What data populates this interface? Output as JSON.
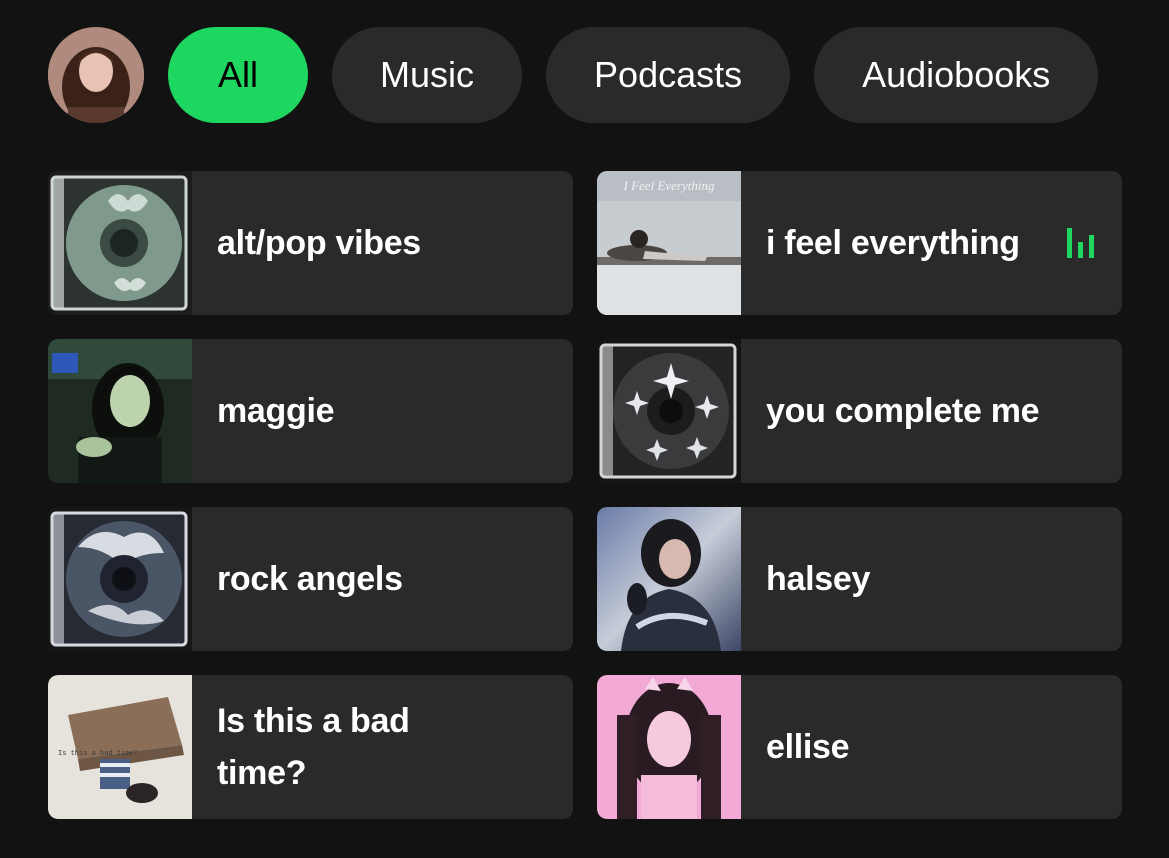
{
  "filters": [
    {
      "label": "All",
      "active": true
    },
    {
      "label": "Music",
      "active": false
    },
    {
      "label": "Podcasts",
      "active": false
    },
    {
      "label": "Audiobooks",
      "active": false
    }
  ],
  "accent_color": "#1ed760",
  "tiles": [
    {
      "title": "alt/pop vibes",
      "art": "clear-cd-case-butterfly"
    },
    {
      "title": "i feel everything",
      "art": "album-cover-i-feel-everything",
      "cover_text": "I Feel Everything",
      "now_playing": true
    },
    {
      "title": "maggie",
      "art": "portrait-green-tint"
    },
    {
      "title": "you complete me",
      "art": "clear-cd-case-sparkles"
    },
    {
      "title": "rock angels",
      "art": "clear-cd-case-clouds"
    },
    {
      "title": "halsey",
      "art": "portrait-chrome-jacket"
    },
    {
      "title": "Is this a bad time?",
      "art": "album-cover-is-this-a-bad-time",
      "cover_text": "Is this a bad time?"
    },
    {
      "title": "ellise",
      "art": "portrait-pink-pigtails"
    }
  ]
}
